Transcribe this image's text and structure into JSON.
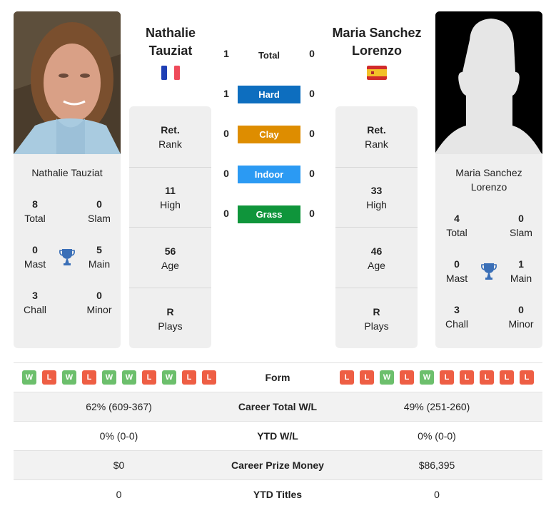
{
  "players": [
    {
      "name_heading": [
        "Nathalie",
        "Tauziat"
      ],
      "card_name": [
        "Nathalie Tauziat"
      ],
      "flag": "france-flag",
      "photo": "player-photo",
      "titles": {
        "total": {
          "value": "8",
          "label": "Total"
        },
        "slam": {
          "value": "0",
          "label": "Slam"
        },
        "mast": {
          "value": "0",
          "label": "Mast"
        },
        "main": {
          "value": "5",
          "label": "Main"
        },
        "chall": {
          "value": "3",
          "label": "Chall"
        },
        "minor": {
          "value": "0",
          "label": "Minor"
        }
      },
      "rank": {
        "value": "Ret.",
        "label": "Rank"
      },
      "high": {
        "value": "11",
        "label": "High"
      },
      "age": {
        "value": "56",
        "label": "Age"
      },
      "plays": {
        "value": "R",
        "label": "Plays"
      }
    },
    {
      "name_heading": [
        "Maria Sanchez",
        "Lorenzo"
      ],
      "card_name": [
        "Maria Sanchez",
        "Lorenzo"
      ],
      "flag": "spain-flag",
      "photo": "placeholder-silhouette",
      "titles": {
        "total": {
          "value": "4",
          "label": "Total"
        },
        "slam": {
          "value": "0",
          "label": "Slam"
        },
        "mast": {
          "value": "0",
          "label": "Mast"
        },
        "main": {
          "value": "1",
          "label": "Main"
        },
        "chall": {
          "value": "3",
          "label": "Chall"
        },
        "minor": {
          "value": "0",
          "label": "Minor"
        }
      },
      "rank": {
        "value": "Ret.",
        "label": "Rank"
      },
      "high": {
        "value": "33",
        "label": "High"
      },
      "age": {
        "value": "46",
        "label": "Age"
      },
      "plays": {
        "value": "R",
        "label": "Plays"
      }
    }
  ],
  "h2h": [
    {
      "label": "Total",
      "left": "1",
      "right": "0",
      "color": ""
    },
    {
      "label": "Hard",
      "left": "1",
      "right": "0",
      "color": "#0d6ebf"
    },
    {
      "label": "Clay",
      "left": "0",
      "right": "0",
      "color": "#de8d00"
    },
    {
      "label": "Indoor",
      "left": "0",
      "right": "0",
      "color": "#2b9af3"
    },
    {
      "label": "Grass",
      "left": "0",
      "right": "0",
      "color": "#0f953b"
    }
  ],
  "comparison": {
    "form_label": "Form",
    "form_left": [
      "W",
      "L",
      "W",
      "L",
      "W",
      "W",
      "L",
      "W",
      "L",
      "L"
    ],
    "form_right": [
      "L",
      "L",
      "W",
      "L",
      "W",
      "L",
      "L",
      "L",
      "L",
      "L"
    ],
    "rows": [
      {
        "label": "Career Total W/L",
        "left": "62% (609-367)",
        "right": "49% (251-260)"
      },
      {
        "label": "YTD W/L",
        "left": "0% (0-0)",
        "right": "0% (0-0)"
      },
      {
        "label": "Career Prize Money",
        "left": "$0",
        "right": "$86,395"
      },
      {
        "label": "YTD Titles",
        "left": "0",
        "right": "0"
      }
    ]
  },
  "colors": {
    "win": "#6cbf6c",
    "loss": "#ee5e44",
    "trophy": "#3a6fb7",
    "card_bg": "#efefef"
  }
}
